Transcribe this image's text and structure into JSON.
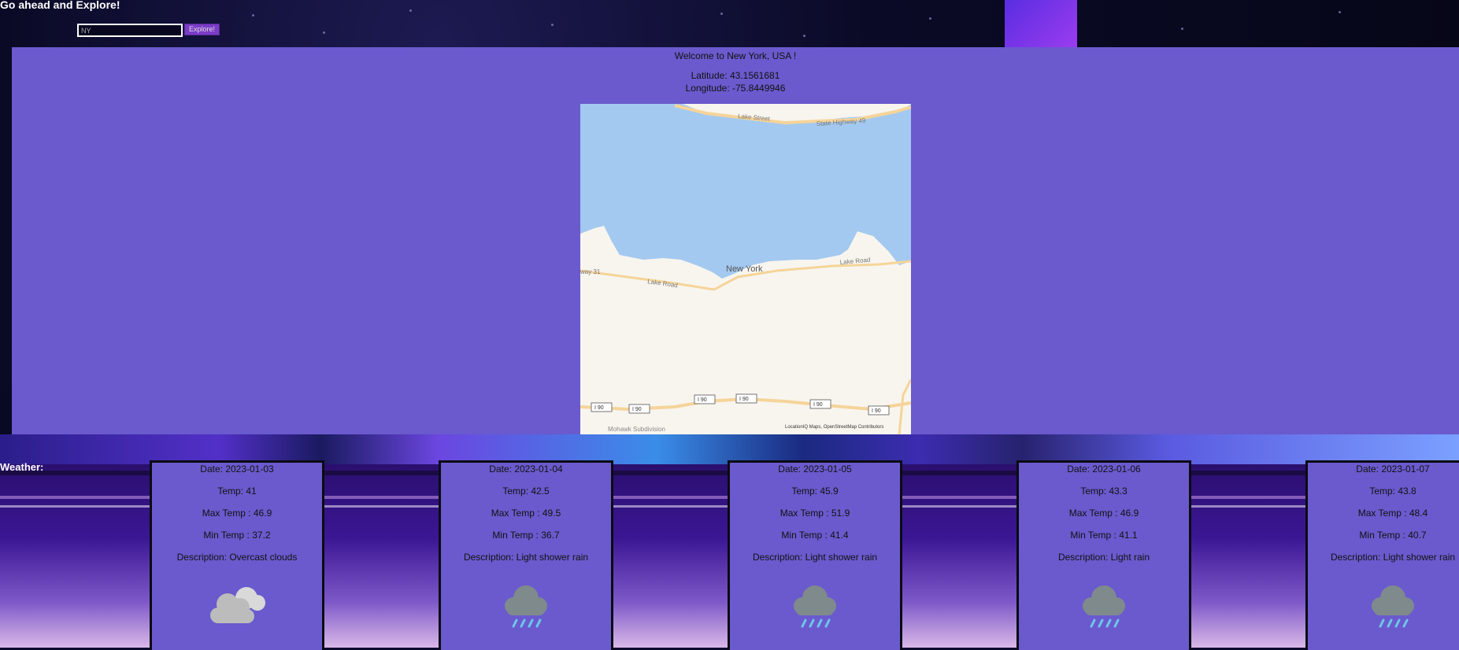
{
  "header": {
    "title": "Go ahead and Explore!"
  },
  "search": {
    "value": "NY",
    "button_label": "Explore!"
  },
  "location": {
    "welcome": "Welcome to New York, USA !",
    "latitude_text": "Latitude: 43.1561681",
    "longitude_text": "Longitude: -75.8449946"
  },
  "map": {
    "city_label": "New York",
    "roads": [
      "Lake Street",
      "State Highway 49",
      "way 31",
      "Lake Road",
      "Lake Road",
      "Mohawk Subdivision"
    ],
    "highway_shield": "I 90",
    "attribution": "LocationIQ Maps, OpenStreetMap Contributors"
  },
  "weather": {
    "label": "Weather:",
    "cards": [
      {
        "date": "Date: 2023-01-03",
        "temp": "Temp: 41",
        "max": "Max Temp : 46.9",
        "min": "Min Temp : 37.2",
        "desc": "Description: Overcast clouds",
        "icon": "cloud-icon"
      },
      {
        "date": "Date: 2023-01-04",
        "temp": "Temp: 42.5",
        "max": "Max Temp : 49.5",
        "min": "Min Temp : 36.7",
        "desc": "Description: Light shower rain",
        "icon": "rain-cloud-icon"
      },
      {
        "date": "Date: 2023-01-05",
        "temp": "Temp: 45.9",
        "max": "Max Temp : 51.9",
        "min": "Min Temp : 41.4",
        "desc": "Description: Light shower rain",
        "icon": "rain-cloud-icon"
      },
      {
        "date": "Date: 2023-01-06",
        "temp": "Temp: 43.3",
        "max": "Max Temp : 46.9",
        "min": "Min Temp : 41.1",
        "desc": "Description: Light rain",
        "icon": "rain-cloud-icon"
      },
      {
        "date": "Date: 2023-01-07",
        "temp": "Temp: 43.8",
        "max": "Max Temp : 48.4",
        "min": "Min Temp : 40.7",
        "desc": "Description: Light shower rain",
        "icon": "rain-cloud-icon"
      }
    ]
  },
  "colors": {
    "panel": "#6a5acd",
    "water": "#a3c9f0",
    "land": "#f8f5ee",
    "road": "#f5d49a",
    "button": "#7b3cc6"
  }
}
